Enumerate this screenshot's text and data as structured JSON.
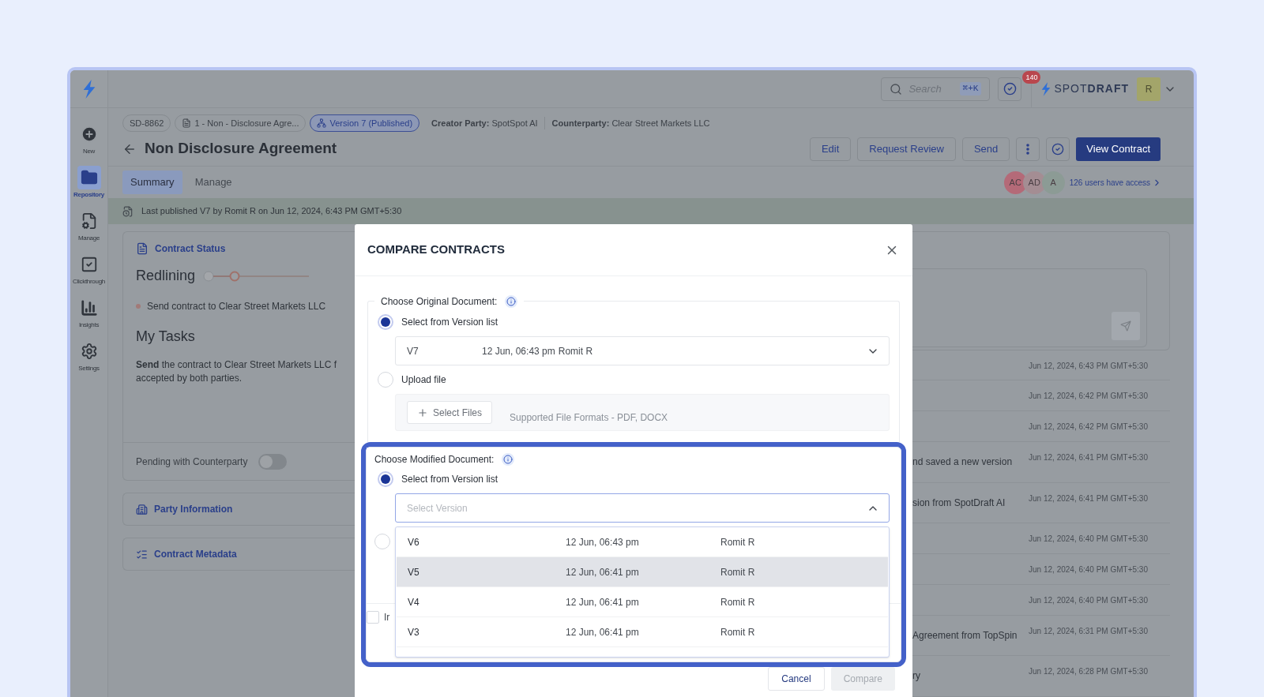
{
  "sidebar": {
    "items": [
      {
        "label": "New",
        "selected": false,
        "kind": "new"
      },
      {
        "label": "Repository",
        "selected": true,
        "kind": "repository"
      },
      {
        "label": "Manage",
        "selected": false,
        "kind": "manage"
      },
      {
        "label": "Clickthrough",
        "selected": false,
        "kind": "clickthrough"
      },
      {
        "label": "Insights",
        "selected": false,
        "kind": "insights"
      },
      {
        "label": "Settings",
        "selected": false,
        "kind": "settings"
      }
    ]
  },
  "topbar": {
    "search": {
      "placeholder": "Search",
      "shortcut": "⌘+K"
    },
    "tasks_badge": "140",
    "brand": "SPOT**DRAFT**",
    "avatar": "R"
  },
  "breadcrumb": {
    "id": "SD-8862",
    "document": "1 - Non - Disclosure Agre...",
    "version": "Version 7 (Published)",
    "creator_label": "Creator Party:",
    "creator": "SpotSpot AI",
    "counterparty_label": "Counterparty:",
    "counterparty": "Clear Street Markets LLC"
  },
  "title": "Non Disclosure Agreement",
  "actions": [
    "Edit",
    "Request Review",
    "Send"
  ],
  "primary_action": "View Contract",
  "tabs": [
    {
      "label": "Summary",
      "selected": true
    },
    {
      "label": "Manage",
      "selected": false
    }
  ],
  "access": {
    "avatars": [
      {
        "initials": "AC",
        "color": "#b46a78"
      },
      {
        "initials": "AD",
        "color": "#a48d93"
      },
      {
        "initials": "A",
        "color": "#8c9b95"
      }
    ],
    "label": "126 users have access"
  },
  "banner": "Last published V7 by Romit R on Jun 12, 2024, 6:43 PM GMT+5:30",
  "contract_status": {
    "title": "Contract Status",
    "stage": "Redlining",
    "task_item": "Send contract to Clear Street Markets LLC",
    "tasks_title": "My Tasks",
    "task_lines": [
      "**Send** the contract to Clear Street Markets LLC f",
      "accepted by both parties."
    ],
    "pending": {
      "label": "Pending with Counterparty",
      "on": false
    }
  },
  "sections": [
    {
      "title": "Party Information",
      "kind": "party"
    },
    {
      "title": "Contract Metadata",
      "kind": "metadata"
    }
  ],
  "activity": [
    {
      "time": "Jun 12, 2024, 6:43 PM GMT+5:30"
    },
    {
      "time": "Jun 12, 2024, 6:42 PM GMT+5:30"
    },
    {
      "time": "Jun 12, 2024, 6:42 PM GMT+5:30"
    },
    {
      "text": "nd saved a new version",
      "time": "Jun 12, 2024, 6:41 PM GMT+5:30"
    },
    {
      "text": "sion from SpotDraft AI",
      "time": "Jun 12, 2024, 6:41 PM GMT+5:30"
    },
    {
      "time": "Jun 12, 2024, 6:40 PM GMT+5:30"
    },
    {
      "time": "Jun 12, 2024, 6:40 PM GMT+5:30"
    },
    {
      "time": "Jun 12, 2024, 6:40 PM GMT+5:30"
    },
    {
      "text": "Agreement from TopSpin",
      "time": "Jun 12, 2024, 6:31 PM GMT+5:30"
    },
    {
      "text": "ry",
      "time": "Jun 12, 2024, 6:28 PM GMT+5:30"
    }
  ],
  "modal": {
    "title": "COMPARE CONTRACTS",
    "original": {
      "legend": "Choose Original Document:",
      "options": [
        {
          "label": "Select from Version list",
          "selected": true
        },
        {
          "label": "Upload file",
          "selected": false
        }
      ],
      "version": {
        "version": "V7",
        "date": "12 Jun, 06:43 pm",
        "author": "Romit R"
      },
      "upload": {
        "button": "Select Files",
        "hint": "Supported File Formats - PDF, DOCX"
      }
    },
    "modified": {
      "legend": "Choose Modified Document:",
      "highlighted": true,
      "options": [
        {
          "label": "Select from Version list",
          "selected": true
        },
        {
          "selected": false
        }
      ],
      "select": {
        "placeholder": "Select Version",
        "expanded": true
      },
      "versions": [
        {
          "version": "V6",
          "date": "12 Jun, 06:43 pm",
          "author": "Romit R",
          "highlighted": false
        },
        {
          "version": "V5",
          "date": "12 Jun, 06:41 pm",
          "author": "Romit R",
          "highlighted": true
        },
        {
          "version": "V4",
          "date": "12 Jun, 06:41 pm",
          "author": "Romit R",
          "highlighted": false
        },
        {
          "version": "V3",
          "date": "12 Jun, 06:41 pm",
          "author": "Romit R",
          "highlighted": false
        }
      ],
      "checkbox": {
        "label": "Ir",
        "checked": false
      }
    },
    "buttons": [
      {
        "label": "Cancel",
        "disabled": false
      },
      {
        "label": "Compare",
        "disabled": true
      }
    ]
  }
}
